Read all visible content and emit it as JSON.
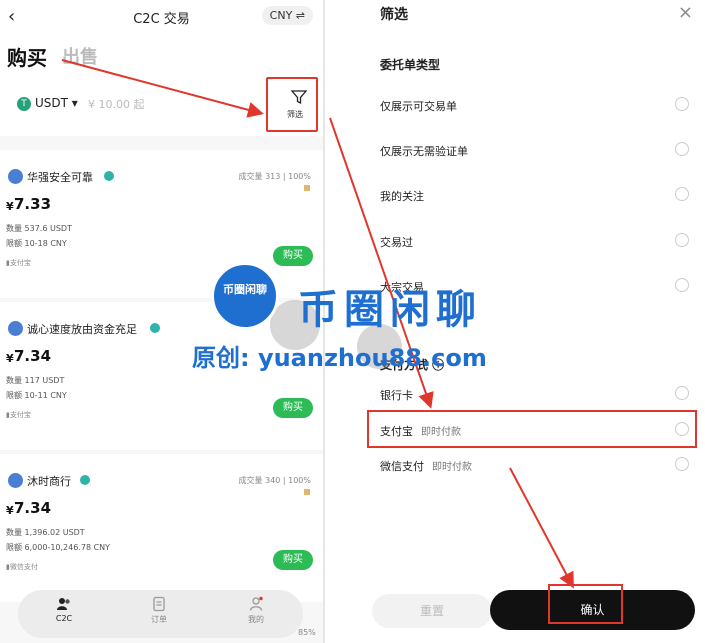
{
  "left": {
    "back_icon": "chevron-left-icon",
    "title": "C2C 交易",
    "currency": "CNY ⇌",
    "tab_buy": "购买",
    "tab_sell": "出售",
    "coin_symbol": "T",
    "coin": "USDT ▾",
    "amount_placeholder": "¥ 10.00 起",
    "filter_label": "筛选",
    "merchants": [
      {
        "name": "华强安全可靠",
        "stats": "成交量 313 | 100%",
        "price": "7.33",
        "qty": "数量  537.6 USDT",
        "limit": "限额  10-18 CNY",
        "pay": "▮支付宝",
        "buy": "购买"
      },
      {
        "name": "诚心速度放由资金充足",
        "stats": "",
        "price": "7.34",
        "qty": "数量  117 USDT",
        "limit": "限额  10-11 CNY",
        "pay": "▮支付宝",
        "buy": "购买"
      },
      {
        "name": "沐时商行",
        "stats": "成交量 340 | 100%",
        "price": "7.34",
        "qty": "数量  1,396.02 USDT",
        "limit": "限额  6,000-10,246.78 CNY",
        "pay": "▮微信支付",
        "buy": "购买"
      }
    ],
    "nav": {
      "c2c": "C2C",
      "orders": "订单",
      "mine": "我的"
    },
    "corner_pct": "85%"
  },
  "right": {
    "title": "筛选",
    "close": "×",
    "section_order_type": "委托单类型",
    "order_options": [
      "仅展示可交易单",
      "仅展示无需验证单",
      "我的关注",
      "交易过",
      "大宗交易"
    ],
    "section_payment": "支付方式 ⓘ",
    "payment_options": [
      {
        "name": "银行卡",
        "sub": ""
      },
      {
        "name": "支付宝",
        "sub": "即时付款"
      },
      {
        "name": "微信支付",
        "sub": "即时付款"
      }
    ],
    "reset": "重置",
    "confirm": "确认"
  },
  "watermark": {
    "badge": "币圈闲聊",
    "main": "币圈闲聊",
    "sub": "原创: yuanzhou88.com"
  },
  "colors": {
    "accent_red": "#e0362c",
    "buy_green": "#2dbb55",
    "watermark_blue": "#1f6fd1"
  }
}
